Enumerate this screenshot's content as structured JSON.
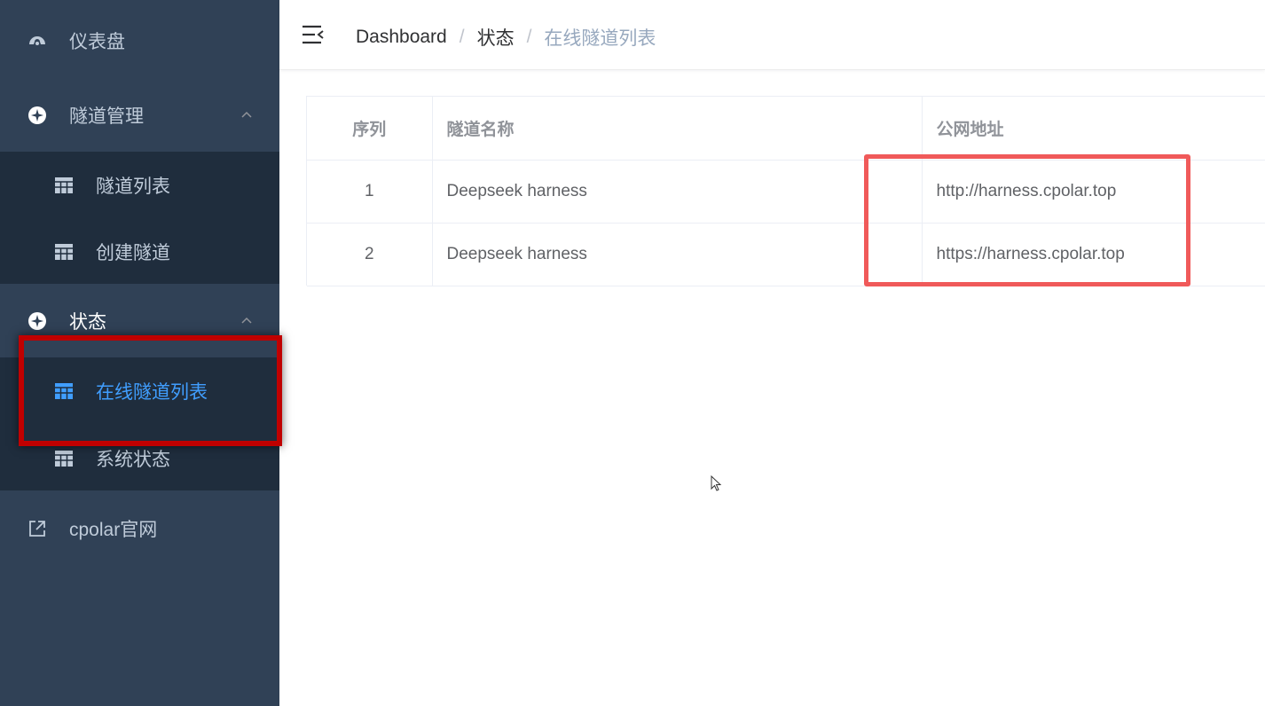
{
  "sidebar": {
    "dashboard": "仪表盘",
    "tunnel_mgmt": "隧道管理",
    "tunnel_list": "隧道列表",
    "create_tunnel": "创建隧道",
    "status": "状态",
    "online_tunnels": "在线隧道列表",
    "system_status": "系统状态",
    "cpolar_site": "cpolar官网"
  },
  "breadcrumb": {
    "home": "Dashboard",
    "section": "状态",
    "current": "在线隧道列表",
    "sep": "/"
  },
  "table": {
    "headers": [
      "序列",
      "隧道名称",
      "公网地址"
    ],
    "rows": [
      [
        "1",
        "Deepseek harness",
        "http://harness.cpolar.top"
      ],
      [
        "2",
        "Deepseek harness",
        "https://harness.cpolar.top"
      ]
    ]
  },
  "colors": {
    "sidebar_bg": "#304156",
    "submenu_bg": "#1f2d3d",
    "active": "#409eff",
    "highlight": "#f05a5a"
  }
}
